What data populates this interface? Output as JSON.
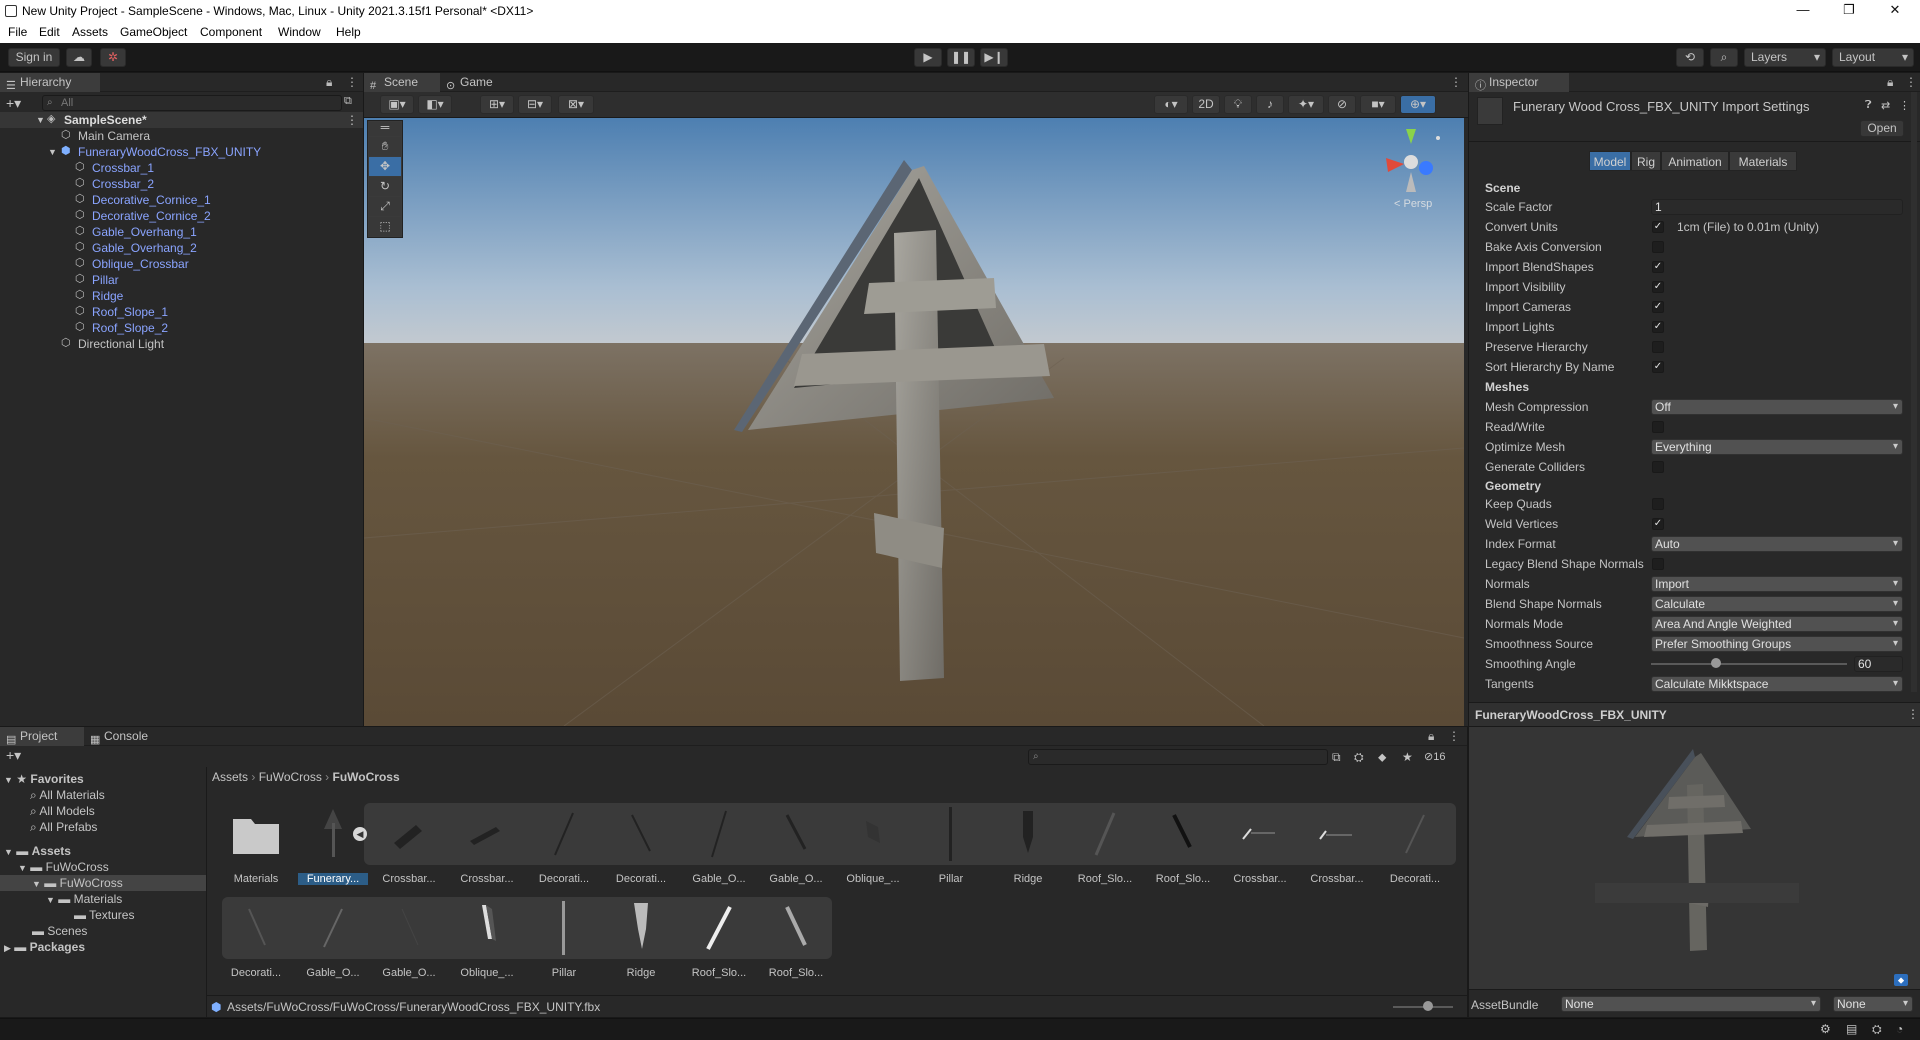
{
  "window": {
    "title": "New Unity Project - SampleScene - Windows, Mac, Linux - Unity 2021.3.15f1 Personal* <DX11>",
    "controls": {
      "minimize": "—",
      "maximize": "❐",
      "close": "✕"
    }
  },
  "menu": [
    "File",
    "Edit",
    "Assets",
    "GameObject",
    "Component",
    "Window",
    "Help"
  ],
  "toolbar": {
    "sign_in": "Sign in",
    "layers": "Layers",
    "layout": "Layout"
  },
  "hierarchy": {
    "tab": "Hierarchy",
    "search_placeholder": "All",
    "scene": "SampleScene*",
    "items": [
      {
        "label": "Main Camera"
      },
      {
        "label": "FuneraryWoodCross_FBX_UNITY"
      },
      {
        "label": "Crossbar_1"
      },
      {
        "label": "Crossbar_2"
      },
      {
        "label": "Decorative_Cornice_1"
      },
      {
        "label": "Decorative_Cornice_2"
      },
      {
        "label": "Gable_Overhang_1"
      },
      {
        "label": "Gable_Overhang_2"
      },
      {
        "label": "Oblique_Crossbar"
      },
      {
        "label": "Pillar"
      },
      {
        "label": "Ridge"
      },
      {
        "label": "Roof_Slope_1"
      },
      {
        "label": "Roof_Slope_2"
      },
      {
        "label": "Directional Light"
      }
    ]
  },
  "scene": {
    "tabs": [
      "Scene",
      "Game"
    ],
    "toggle_2d": "2D",
    "gizmo_label": "< Persp"
  },
  "inspector": {
    "tab": "Inspector",
    "title": "Funerary Wood Cross_FBX_UNITY Import Settings",
    "open": "Open",
    "tabs": [
      "Model",
      "Rig",
      "Animation",
      "Materials"
    ],
    "sections": {
      "scene": "Scene",
      "meshes": "Meshes",
      "geometry": "Geometry"
    },
    "rows": {
      "scale_factor": {
        "label": "Scale Factor",
        "value": "1"
      },
      "convert_units": {
        "label": "Convert Units",
        "checked": true,
        "note": "1cm (File) to 0.01m (Unity)"
      },
      "bake_axis": {
        "label": "Bake Axis Conversion",
        "checked": false
      },
      "import_blendshapes": {
        "label": "Import BlendShapes",
        "checked": true
      },
      "import_visibility": {
        "label": "Import Visibility",
        "checked": true
      },
      "import_cameras": {
        "label": "Import Cameras",
        "checked": true
      },
      "import_lights": {
        "label": "Import Lights",
        "checked": true
      },
      "preserve_hierarchy": {
        "label": "Preserve Hierarchy",
        "checked": false
      },
      "sort_hierarchy": {
        "label": "Sort Hierarchy By Name",
        "checked": true
      },
      "mesh_compression": {
        "label": "Mesh Compression",
        "value": "Off"
      },
      "read_write": {
        "label": "Read/Write",
        "checked": false
      },
      "optimize_mesh": {
        "label": "Optimize Mesh",
        "value": "Everything"
      },
      "generate_colliders": {
        "label": "Generate Colliders",
        "checked": false
      },
      "keep_quads": {
        "label": "Keep Quads",
        "checked": false
      },
      "weld_vertices": {
        "label": "Weld Vertices",
        "checked": true
      },
      "index_format": {
        "label": "Index Format",
        "value": "Auto"
      },
      "legacy_blend": {
        "label": "Legacy Blend Shape Normals",
        "checked": false
      },
      "normals": {
        "label": "Normals",
        "value": "Import"
      },
      "blend_shape_normals": {
        "label": "Blend Shape Normals",
        "value": "Calculate"
      },
      "normals_mode": {
        "label": "Normals Mode",
        "value": "Area And Angle Weighted"
      },
      "smoothness_source": {
        "label": "Smoothness Source",
        "value": "Prefer Smoothing Groups"
      },
      "smoothing_angle": {
        "label": "Smoothing Angle",
        "value": "60",
        "fraction": 0.33
      },
      "tangents": {
        "label": "Tangents",
        "value": "Calculate Mikktspace"
      }
    },
    "preview_title": "FuneraryWoodCross_FBX_UNITY",
    "assetbundle": {
      "label": "AssetBundle",
      "value": "None",
      "variant": "None"
    }
  },
  "project": {
    "tabs": [
      "Project",
      "Console"
    ],
    "hidden_count": "16",
    "breadcrumb": [
      "Assets",
      "FuWoCross",
      "FuWoCross"
    ],
    "favorites": {
      "title": "Favorites",
      "items": [
        "All Materials",
        "All Models",
        "All Prefabs"
      ]
    },
    "tree": [
      "Assets",
      "FuWoCross",
      "FuWoCross",
      "Materials",
      "Textures",
      "Scenes",
      "Packages"
    ],
    "row1": [
      "Materials",
      "Funerary...",
      "Crossbar...",
      "Crossbar...",
      "Decorati...",
      "Decorati...",
      "Gable_O...",
      "Gable_O...",
      "Oblique_...",
      "Pillar",
      "Ridge",
      "Roof_Slo...",
      "Roof_Slo...",
      "Crossbar...",
      "Crossbar...",
      "Decorati..."
    ],
    "row2": [
      "Decorati...",
      "Gable_O...",
      "Gable_O...",
      "Oblique_...",
      "Pillar",
      "Ridge",
      "Roof_Slo...",
      "Roof_Slo..."
    ],
    "path": "Assets/FuWoCross/FuWoCross/FuneraryWoodCross_FBX_UNITY.fbx"
  },
  "colors": {
    "selection": "#2c5d87",
    "blue_text": "#8aa4ff",
    "active_tab": "#3a6ea5"
  }
}
